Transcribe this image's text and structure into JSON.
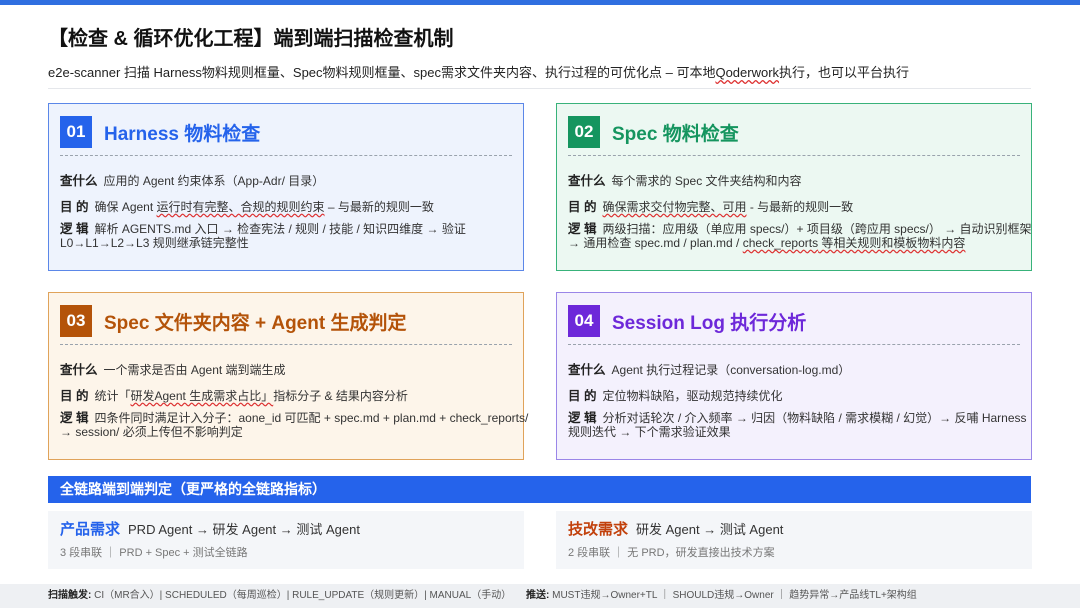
{
  "title": "【检查 & 循环优化工程】端到端扫描检查机制",
  "subtitle": {
    "pre": "e2e-scanner 扫描 Harness物料规则框量、Spec物料规则框量、spec需求文件夹内容、执行过程的可优化点 – 可本地",
    "wavy": "Qoderwork",
    "post": "执行，也可以平台执行"
  },
  "labels": {
    "what": "查什么",
    "goal": "目 的",
    "logic": "逻 辑"
  },
  "cards": [
    {
      "num": "01",
      "title": "Harness 物料检查",
      "what": "应用的 Agent 约束体系（App-Adr/ 目录）",
      "goal_pre": "确保 Agent ",
      "goal_wavy": "运行时有完整、合规的规则约束",
      "goal_post": " – 与最新的规则一致",
      "logic1": "解析 AGENTS.md 入口 → 检查宪法 / 规则 / 技能 / 知识四维度 → 验证",
      "logic2": "L0→L1→L2→L3 规则继承链完整性"
    },
    {
      "num": "02",
      "title": "Spec 物料检查",
      "what": "每个需求的 Spec 文件夹结构和内容",
      "goal_pre": "",
      "goal_wavy": "确保需求交付物完整、可用",
      "goal_post": " - 与最新的规则一致",
      "logic1": "两级扫描：应用级（单应用 specs/）+ 项目级（跨应用 specs/） → 自动识别框架",
      "logic2_pre": "→ 通用检查 spec.md / plan.md / ",
      "logic2_wavy": "check_reports",
      "logic2_post": " 等相关规则和模板物料内容"
    },
    {
      "num": "03",
      "title": "Spec 文件夹内容 + Agent 生成判定",
      "what": "一个需求是否由 Agent 端到端生成",
      "goal_pre": "统计「",
      "goal_wavy": "研发Agent 生成需求占比」",
      "goal_post": "指标分子 & 结果内容分析",
      "logic1": "四条件同时满足计入分子：aone_id 可匹配 + spec.md + plan.md + check_reports/",
      "logic2": "→ session/ 必须上传但不影响判定"
    },
    {
      "num": "04",
      "title": "Session Log 执行分析",
      "what": "Agent 执行过程记录（conversation-log.md）",
      "goal_pre": "定位物料缺陷，驱动规范持续优化",
      "goal_wavy": "",
      "goal_post": "",
      "logic1": "分析对话轮次 / 介入频率 → 归因（物料缺陷 / 需求模糊 / 幻觉）→ 反哺 Harness",
      "logic2": "规则迭代 → 下个需求验证效果"
    }
  ],
  "chain_title": "全链路端到端判定（更严格的全链路指标）",
  "panels": [
    {
      "name": "产品需求",
      "flow": "PRD Agent → 研发 Agent → 测试 Agent",
      "sub": "3 段串联 ｜ PRD + Spec + 测试全链路"
    },
    {
      "name": "技改需求",
      "flow": "研发 Agent → 测试 Agent",
      "sub": "2 段串联 ｜ 无 PRD，研发直接出技术方案"
    }
  ],
  "footer": {
    "trigger_label": "扫描触发:",
    "trigger_text": "CI（MR合入）| SCHEDULED（每周巡检）| RULE_UPDATE（规则更新）| MANUAL（手动）",
    "push_label": "推送:",
    "push_text": "MUST违规→Owner+TL ｜ SHOULD违规→Owner ｜ 趋势异常→产品线TL+架构组"
  },
  "colors": {
    "blue": "#2563eb",
    "green": "#15955f",
    "orange": "#b45309",
    "purple": "#6d28d9"
  }
}
